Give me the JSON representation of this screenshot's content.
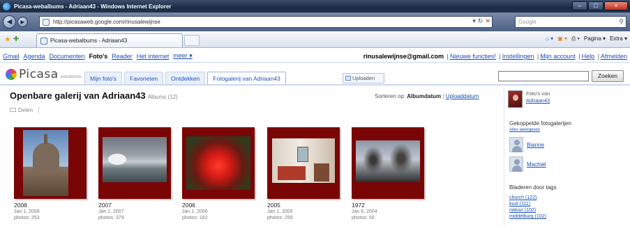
{
  "window": {
    "title": "Picasa-webalbums - Adriaan43 - Windows Internet Explorer",
    "controls": [
      "–",
      "□",
      "×"
    ]
  },
  "browser": {
    "url": "http://picasaweb.google.com/rinusalewijnse",
    "search_placeholder": "Google",
    "tab_title": "Picasa-webalbums - Adriaan43",
    "commands": {
      "pagina": "Pagina",
      "extra": "Extra"
    }
  },
  "google_bar": {
    "links": [
      "Gmail",
      "Agenda",
      "Documenten",
      "Foto's",
      "Reader",
      "Het internet",
      "meer ▾"
    ],
    "current": "Foto's",
    "email": "rinusalewijnse@gmail.com",
    "right_links": [
      "Nieuwe functies!",
      "Instellingen",
      "Mijn account",
      "Help",
      "Afmelden"
    ]
  },
  "picasa": {
    "logo": "Picasa",
    "logo_sub": "webalbums",
    "tabs": [
      "Mijn foto's",
      "Favorieten",
      "Ontdekken",
      "Fotogalerij van Adriaan43"
    ],
    "active_tab": "Fotogalerij van Adriaan43",
    "upload_label": "Uploaden",
    "search_button": "Zoeken"
  },
  "gallery": {
    "title": "Openbare galerij van Adriaan43",
    "album_count": "Albums (12)",
    "sort_label": "Sorteren op:",
    "sort_active": "Albumdatum",
    "sort_other": "Uploaddatum",
    "share_label": "Delen",
    "albums": [
      {
        "name": "2008",
        "date": "Jan 1, 2008",
        "photos": "photos: 253"
      },
      {
        "name": "2007",
        "date": "Jan 1, 2007",
        "photos": "photos: 379"
      },
      {
        "name": "2006",
        "date": "Jan 1, 2006",
        "photos": "photos: 182"
      },
      {
        "name": "2005",
        "date": "Jan 1, 2005",
        "photos": "photos: 259"
      },
      {
        "name": "1972",
        "date": "Jan 6, 2004",
        "photos": "photos: 50"
      }
    ]
  },
  "sidebar": {
    "owner_prefix": "Foto's van",
    "owner_name": "Adriaan43",
    "linked_heading": "Gekoppelde fotogalerijen",
    "show_all": "Alles weergeven",
    "people": [
      "Bianne",
      "Machiel"
    ],
    "tags_heading": "Bladeren door tags",
    "tags": [
      "church (122)",
      "kust (111)",
      "natuur (102)",
      "middelburg (102)"
    ]
  }
}
